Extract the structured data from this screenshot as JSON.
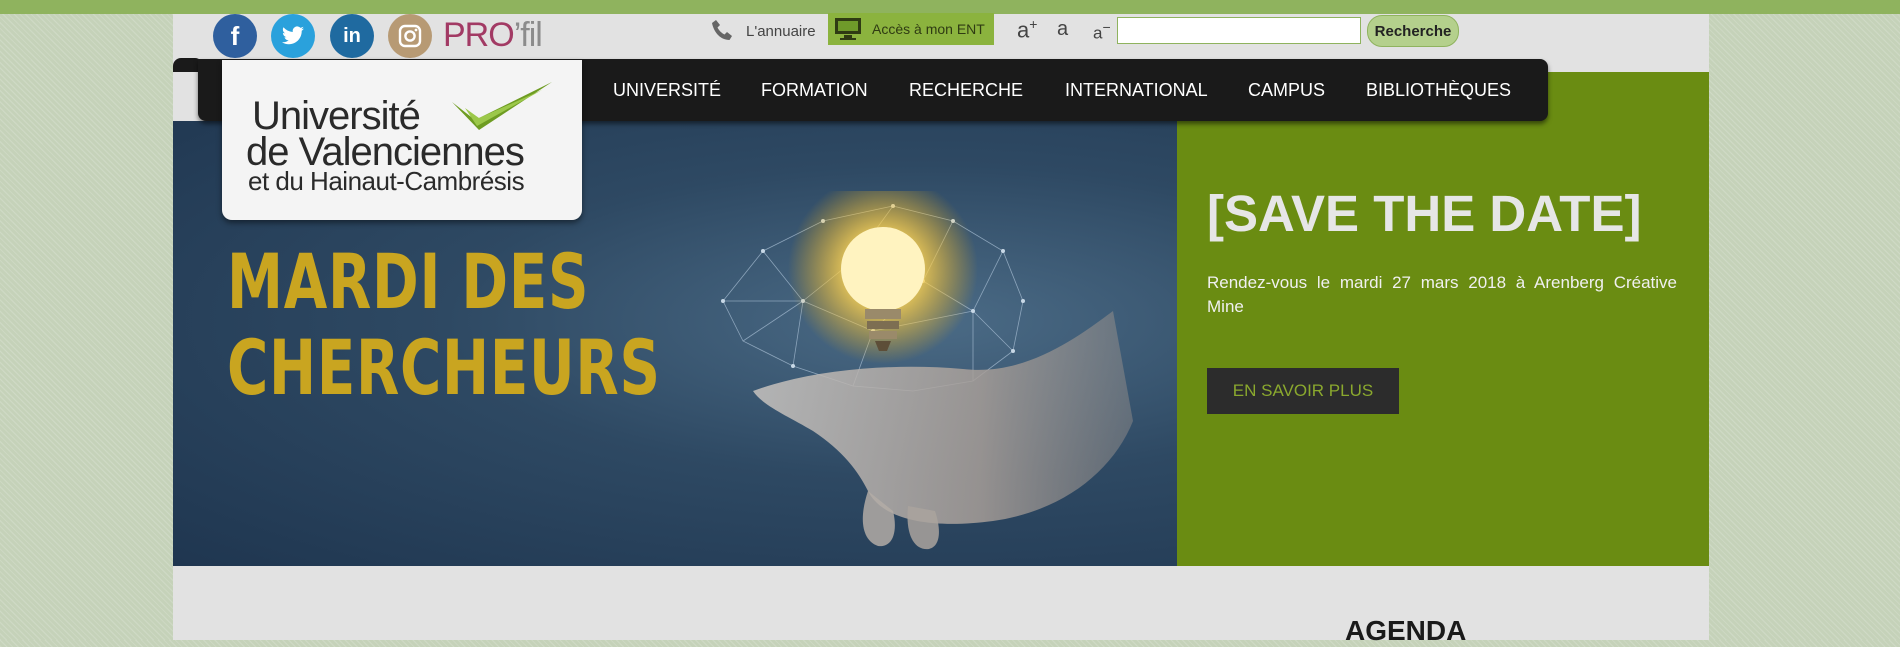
{
  "topbar": {
    "social": [
      {
        "name": "facebook",
        "icon": "facebook-icon",
        "glyph": "f",
        "color": "#2f5f9e"
      },
      {
        "name": "twitter",
        "icon": "twitter-icon",
        "color": "#2aa1dc"
      },
      {
        "name": "linkedin",
        "icon": "linkedin-icon",
        "glyph": "in",
        "color": "#1f6aa0"
      },
      {
        "name": "instagram",
        "icon": "instagram-icon",
        "color": "#b79a74"
      }
    ],
    "profil_brand": "PRO",
    "profil_suffix": "’fil",
    "annuaire_label": "L'annuaire",
    "ent_label": "Accès à mon ENT",
    "font_increase": "a",
    "font_normal": "a",
    "font_decrease": "a",
    "search_placeholder": "",
    "search_button": "Recherche"
  },
  "nav": {
    "items": [
      "UNIVERSITÉ",
      "FORMATION",
      "RECHERCHE",
      "INTERNATIONAL",
      "CAMPUS",
      "BIBLIOTHÈQUES"
    ]
  },
  "logo": {
    "line1": "Université",
    "line2": "de Valenciennes",
    "line3": "et du Hainaut-Cambrésis"
  },
  "hero": {
    "title_line1": "MARDI DES",
    "title_line2": "CHERCHEURS",
    "headline": "[SAVE THE DATE]",
    "description": "Rendez-vous le mardi 27 mars 2018 à Arenberg Créative Mine",
    "cta": "EN SAVOIR PLUS"
  },
  "sections": {
    "agenda_title": "AGENDA"
  },
  "colors": {
    "accent_green": "#6a8c12",
    "title_gold": "#c9a520",
    "nav_bg": "#1a1a1a"
  }
}
